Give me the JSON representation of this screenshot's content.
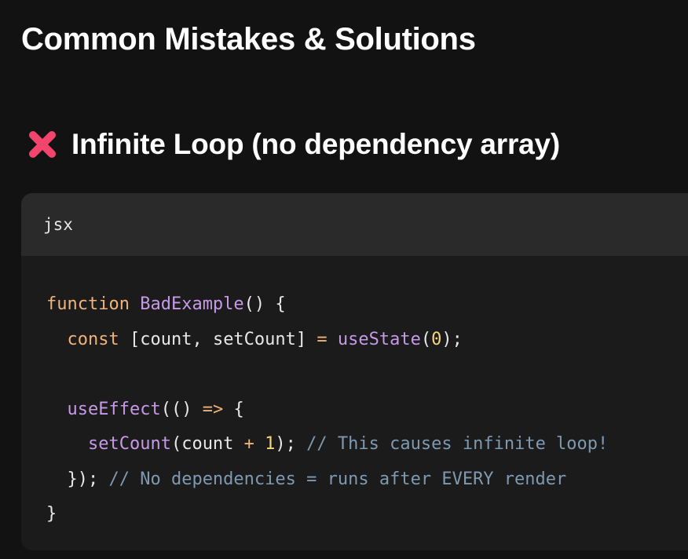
{
  "page_title": "Common Mistakes & Solutions",
  "section": {
    "icon": "cross-mark-icon",
    "icon_color": "#f2446c",
    "heading": "Infinite Loop (no dependency array)"
  },
  "code_block": {
    "language": "jsx",
    "lines": [
      [
        {
          "t": "function ",
          "c": "kw"
        },
        {
          "t": "BadExample",
          "c": "fn"
        },
        {
          "t": "() {",
          "c": "pl"
        }
      ],
      [
        {
          "t": "  ",
          "c": "pl"
        },
        {
          "t": "const ",
          "c": "kw"
        },
        {
          "t": "[count, setCount] ",
          "c": "pl"
        },
        {
          "t": "= ",
          "c": "op"
        },
        {
          "t": "useState",
          "c": "fn"
        },
        {
          "t": "(",
          "c": "pl"
        },
        {
          "t": "0",
          "c": "num"
        },
        {
          "t": ");",
          "c": "pl"
        }
      ],
      [
        {
          "t": "",
          "c": "pl"
        }
      ],
      [
        {
          "t": "  ",
          "c": "pl"
        },
        {
          "t": "useEffect",
          "c": "fn"
        },
        {
          "t": "(() ",
          "c": "pl"
        },
        {
          "t": "=> ",
          "c": "op"
        },
        {
          "t": "{",
          "c": "pl"
        }
      ],
      [
        {
          "t": "    ",
          "c": "pl"
        },
        {
          "t": "setCount",
          "c": "fn"
        },
        {
          "t": "(count ",
          "c": "pl"
        },
        {
          "t": "+ ",
          "c": "op"
        },
        {
          "t": "1",
          "c": "num"
        },
        {
          "t": "); ",
          "c": "pl"
        },
        {
          "t": "// This causes infinite loop!",
          "c": "cm"
        }
      ],
      [
        {
          "t": "  }); ",
          "c": "pl"
        },
        {
          "t": "// No dependencies = runs after EVERY render",
          "c": "cm"
        }
      ],
      [
        {
          "t": "}",
          "c": "pl"
        }
      ]
    ]
  }
}
